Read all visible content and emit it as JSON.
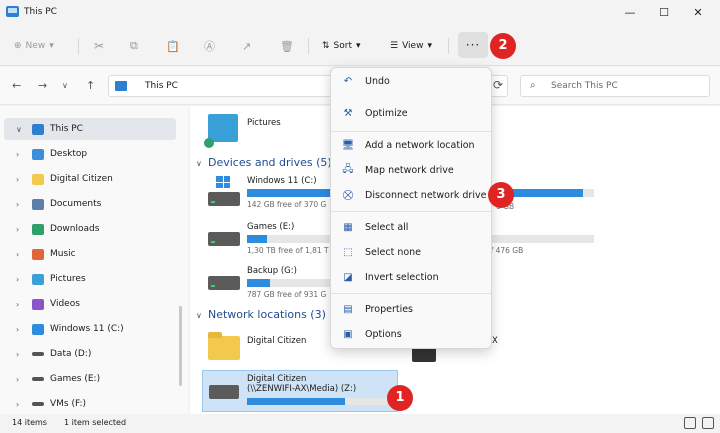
{
  "window": {
    "title": "This PC"
  },
  "window_controls": {
    "minimize": "—",
    "maximize": "☐",
    "close": "✕"
  },
  "toolbar": {
    "new_label": "New",
    "sort_label": "Sort",
    "view_label": "View",
    "more_label": "···"
  },
  "address": {
    "path": "This PC",
    "search_placeholder": "Search This PC"
  },
  "sidebar": {
    "items": [
      {
        "label": "This PC",
        "color": "#2f7fd1"
      },
      {
        "label": "Desktop",
        "color": "#3a8fd8"
      },
      {
        "label": "Digital Citizen",
        "color": "#f2c94c"
      },
      {
        "label": "Documents",
        "color": "#5a7fa8"
      },
      {
        "label": "Downloads",
        "color": "#2ea06b"
      },
      {
        "label": "Music",
        "color": "#e0643c"
      },
      {
        "label": "Pictures",
        "color": "#3aa0d8"
      },
      {
        "label": "Videos",
        "color": "#8a55c9"
      },
      {
        "label": "Windows 11 (C:)",
        "color": "#2d8cde"
      },
      {
        "label": "Data (D:)",
        "color": "#555555"
      },
      {
        "label": "Games (E:)",
        "color": "#555555"
      },
      {
        "label": "VMs (F:)",
        "color": "#555555"
      }
    ]
  },
  "content": {
    "pictures_label": "Pictures",
    "devices_header": "Devices and drives (5)",
    "drives": [
      {
        "name": "Windows 11 (C:)",
        "free": "142 GB free of 370 G",
        "fill": 0.62,
        "right_free": "6 GB",
        "right_fill": 0.9
      },
      {
        "name": "Games (E:)",
        "free": "1,30 TB free of 1,81 T",
        "fill": 0.13,
        "right_free": "of 476 GB",
        "right_fill": 0.0
      },
      {
        "name": "Backup (G:)",
        "free": "787 GB free of 931 G",
        "fill": 0.15
      }
    ],
    "network_header": "Network locations (3)",
    "network": [
      {
        "name": "Digital Citizen",
        "right_text": "X"
      },
      {
        "name": "Digital Citizen",
        "name2": "(\\\\ZENWIFI-AX\\Media) (Z:)",
        "fill": 0.7
      }
    ]
  },
  "menu": {
    "items": [
      {
        "label": "Undo",
        "icon": "undo-icon",
        "glyph": "↶"
      },
      {
        "label": "Optimize",
        "icon": "optimize-icon",
        "glyph": "⚒"
      },
      {
        "label": "Add a network location",
        "icon": "network-location-icon",
        "glyph": "🖥"
      },
      {
        "label": "Map network drive",
        "icon": "map-drive-icon",
        "glyph": "🖧"
      },
      {
        "label": "Disconnect network drive",
        "icon": "disconnect-drive-icon",
        "glyph": "⛒"
      },
      {
        "label": "Select all",
        "icon": "select-all-icon",
        "glyph": "▦"
      },
      {
        "label": "Select none",
        "icon": "select-none-icon",
        "glyph": "⬚"
      },
      {
        "label": "Invert selection",
        "icon": "invert-selection-icon",
        "glyph": "◪"
      },
      {
        "label": "Properties",
        "icon": "properties-icon",
        "glyph": "▤"
      },
      {
        "label": "Options",
        "icon": "options-icon",
        "glyph": "▣"
      }
    ]
  },
  "annotations": {
    "badge1": "1",
    "badge2": "2",
    "badge3": "3",
    "color": "#e02424"
  },
  "status": {
    "count": "14 items",
    "selected": "1 item selected"
  }
}
